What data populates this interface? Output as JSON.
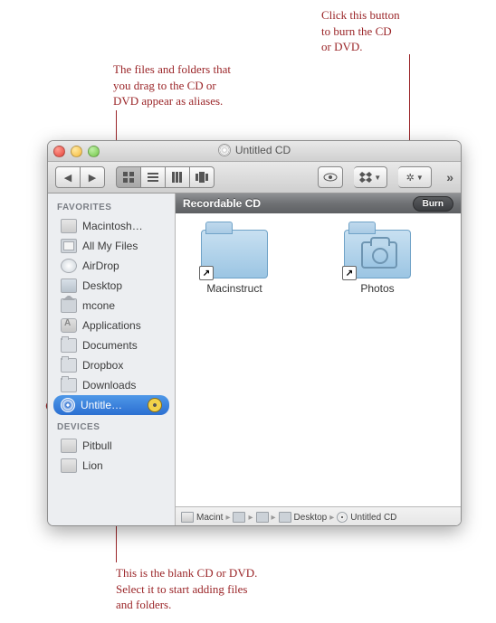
{
  "annotations": {
    "top_right": "Click this button\nto burn the CD\nor DVD.",
    "top_left": "The files and folders that\nyou drag to the CD or\nDVD appear as aliases.",
    "bottom": "This is the blank CD or DVD.\nSelect it to start adding files\nand folders."
  },
  "window": {
    "title": "Untitled CD"
  },
  "sidebar": {
    "favorites_heading": "FAVORITES",
    "devices_heading": "DEVICES",
    "items": {
      "macintosh_hd": "Macintosh…",
      "all_my_files": "All My Files",
      "airdrop": "AirDrop",
      "desktop": "Desktop",
      "mcone": "mcone",
      "applications": "Applications",
      "documents": "Documents",
      "dropbox": "Dropbox",
      "downloads": "Downloads",
      "untitled_cd": "Untitle…",
      "pitbull": "Pitbull",
      "lion": "Lion"
    }
  },
  "content": {
    "header": "Recordable CD",
    "burn_button": "Burn",
    "items": {
      "macinstruct": "Macinstruct",
      "photos": "Photos"
    }
  },
  "pathbar": {
    "macintosh": "Macint",
    "mcone": "",
    "desktop": "Desktop",
    "untitled": "Untitled CD"
  }
}
